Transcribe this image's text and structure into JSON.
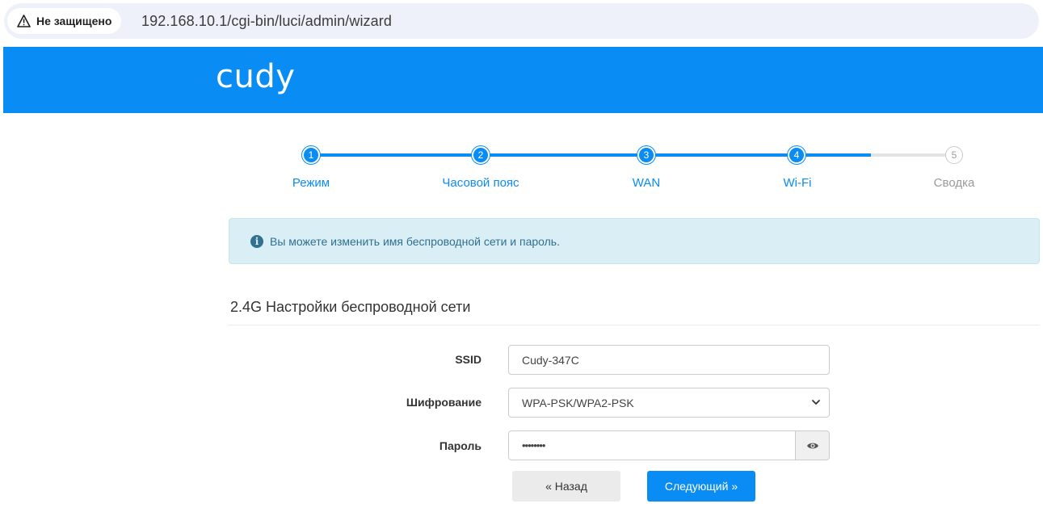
{
  "browser": {
    "security_label": "Не защищено",
    "url": "192.168.10.1/cgi-bin/luci/admin/wizard"
  },
  "header": {
    "logo_text": "cudy",
    "brand_color": "#0a8cf5"
  },
  "stepper": {
    "steps": [
      {
        "number": "1",
        "label": "Режим",
        "state": "done"
      },
      {
        "number": "2",
        "label": "Часовой пояс",
        "state": "done"
      },
      {
        "number": "3",
        "label": "WAN",
        "state": "done"
      },
      {
        "number": "4",
        "label": "Wi-Fi",
        "state": "current"
      },
      {
        "number": "5",
        "label": "Сводка",
        "state": "todo"
      }
    ]
  },
  "alert": {
    "icon": "info-icon",
    "text": "Вы можете изменить имя беспроводной сети и пароль."
  },
  "section": {
    "title": "2.4G Настройки беспроводной сети"
  },
  "form": {
    "ssid_label": "SSID",
    "ssid_value": "Cudy-347C",
    "encryption_label": "Шифрование",
    "encryption_value": "WPA-PSK/WPA2-PSK",
    "password_label": "Пароль",
    "password_value": "••••••••"
  },
  "buttons": {
    "back": "« Назад",
    "next": "Следующий »"
  }
}
